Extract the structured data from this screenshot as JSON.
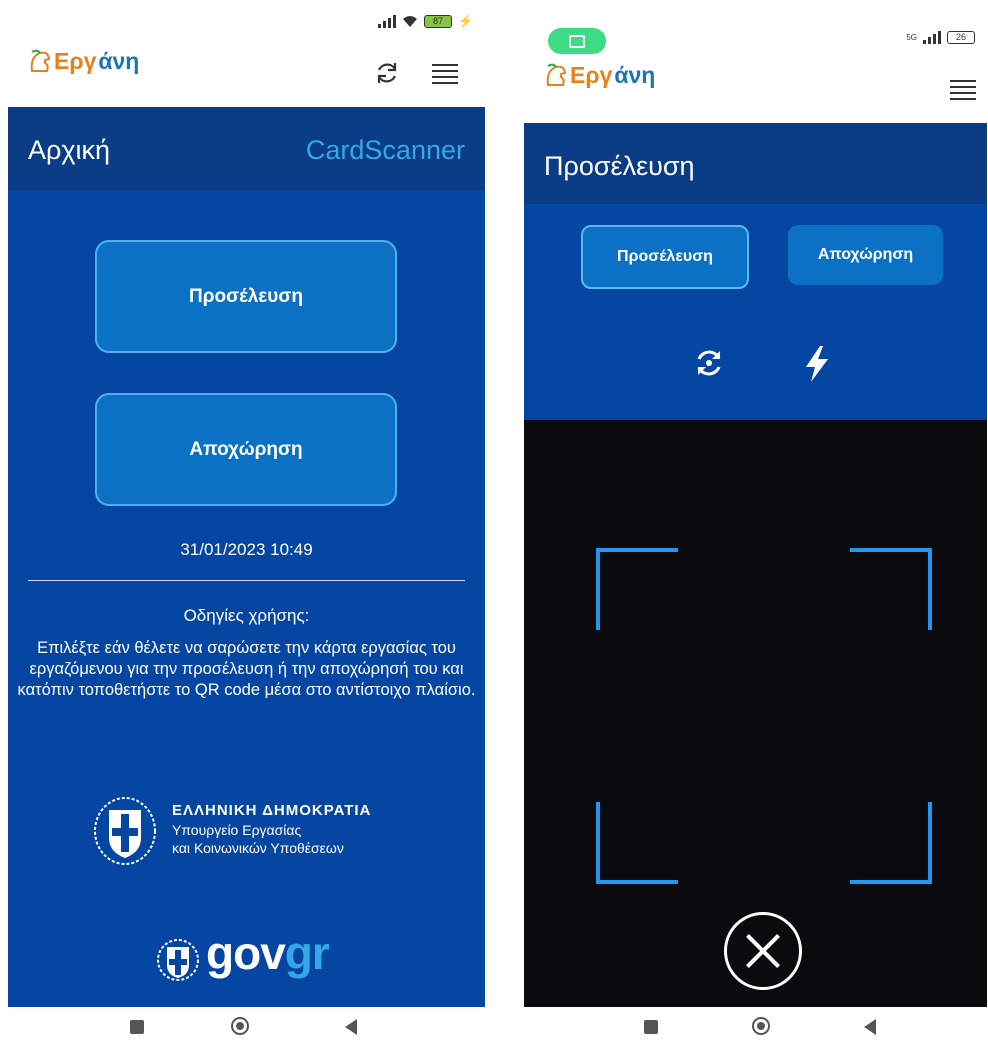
{
  "colors": {
    "header_band": "#0a3d86",
    "body_blue": "#0546a2",
    "button_blue": "#0a71c4",
    "button_border": "#4fb0f0",
    "accent_light_blue": "#33a7e8",
    "scanner_frame": "#2196f3",
    "camera_bg": "#0b0b0d",
    "logo_orange": "#e6811b",
    "logo_blue": "#1e73b8"
  },
  "left": {
    "status": {
      "battery": "87"
    },
    "app": {
      "logo_part1": "Εργ",
      "logo_part2": "άνη"
    },
    "header": {
      "title": "Αρχική",
      "tab": "CardScanner"
    },
    "buttons": {
      "arrival": "Προσέλευση",
      "departure": "Αποχώρηση"
    },
    "datetime": "31/01/2023 10:49",
    "instructions": {
      "title": "Οδηγίες χρήσης:",
      "text": "Επιλέξτε εάν θέλετε να σαρώσετε την κάρτα εργασίας του εργαζόμενου για την προσέλευση ή την αποχώρησή του και κατόπιν τοποθετήστε το QR code μέσα στο αντίστοιχο πλαίσιο."
    },
    "government": {
      "line1": "ΕΛΛΗΝΙΚΗ ΔΗΜΟΚΡΑΤΙΑ",
      "line2": "Υπουργείο Εργασίας",
      "line3": "και Κοινωνικών Υποθέσεων"
    },
    "footer": {
      "gov": "gov",
      "gr": "gr"
    }
  },
  "right": {
    "status": {
      "network": "5G",
      "battery": "26"
    },
    "app": {
      "logo_part1": "Εργ",
      "logo_part2": "άνη"
    },
    "header": {
      "title": "Προσέλευση"
    },
    "segments": {
      "arrival": "Προσέλευση",
      "departure": "Αποχώρηση"
    }
  },
  "icons": [
    "refresh-icon",
    "menu-icon",
    "switch-camera-icon",
    "flash-icon",
    "close-icon",
    "coat-of-arms-icon",
    "helmet-logo-icon"
  ]
}
